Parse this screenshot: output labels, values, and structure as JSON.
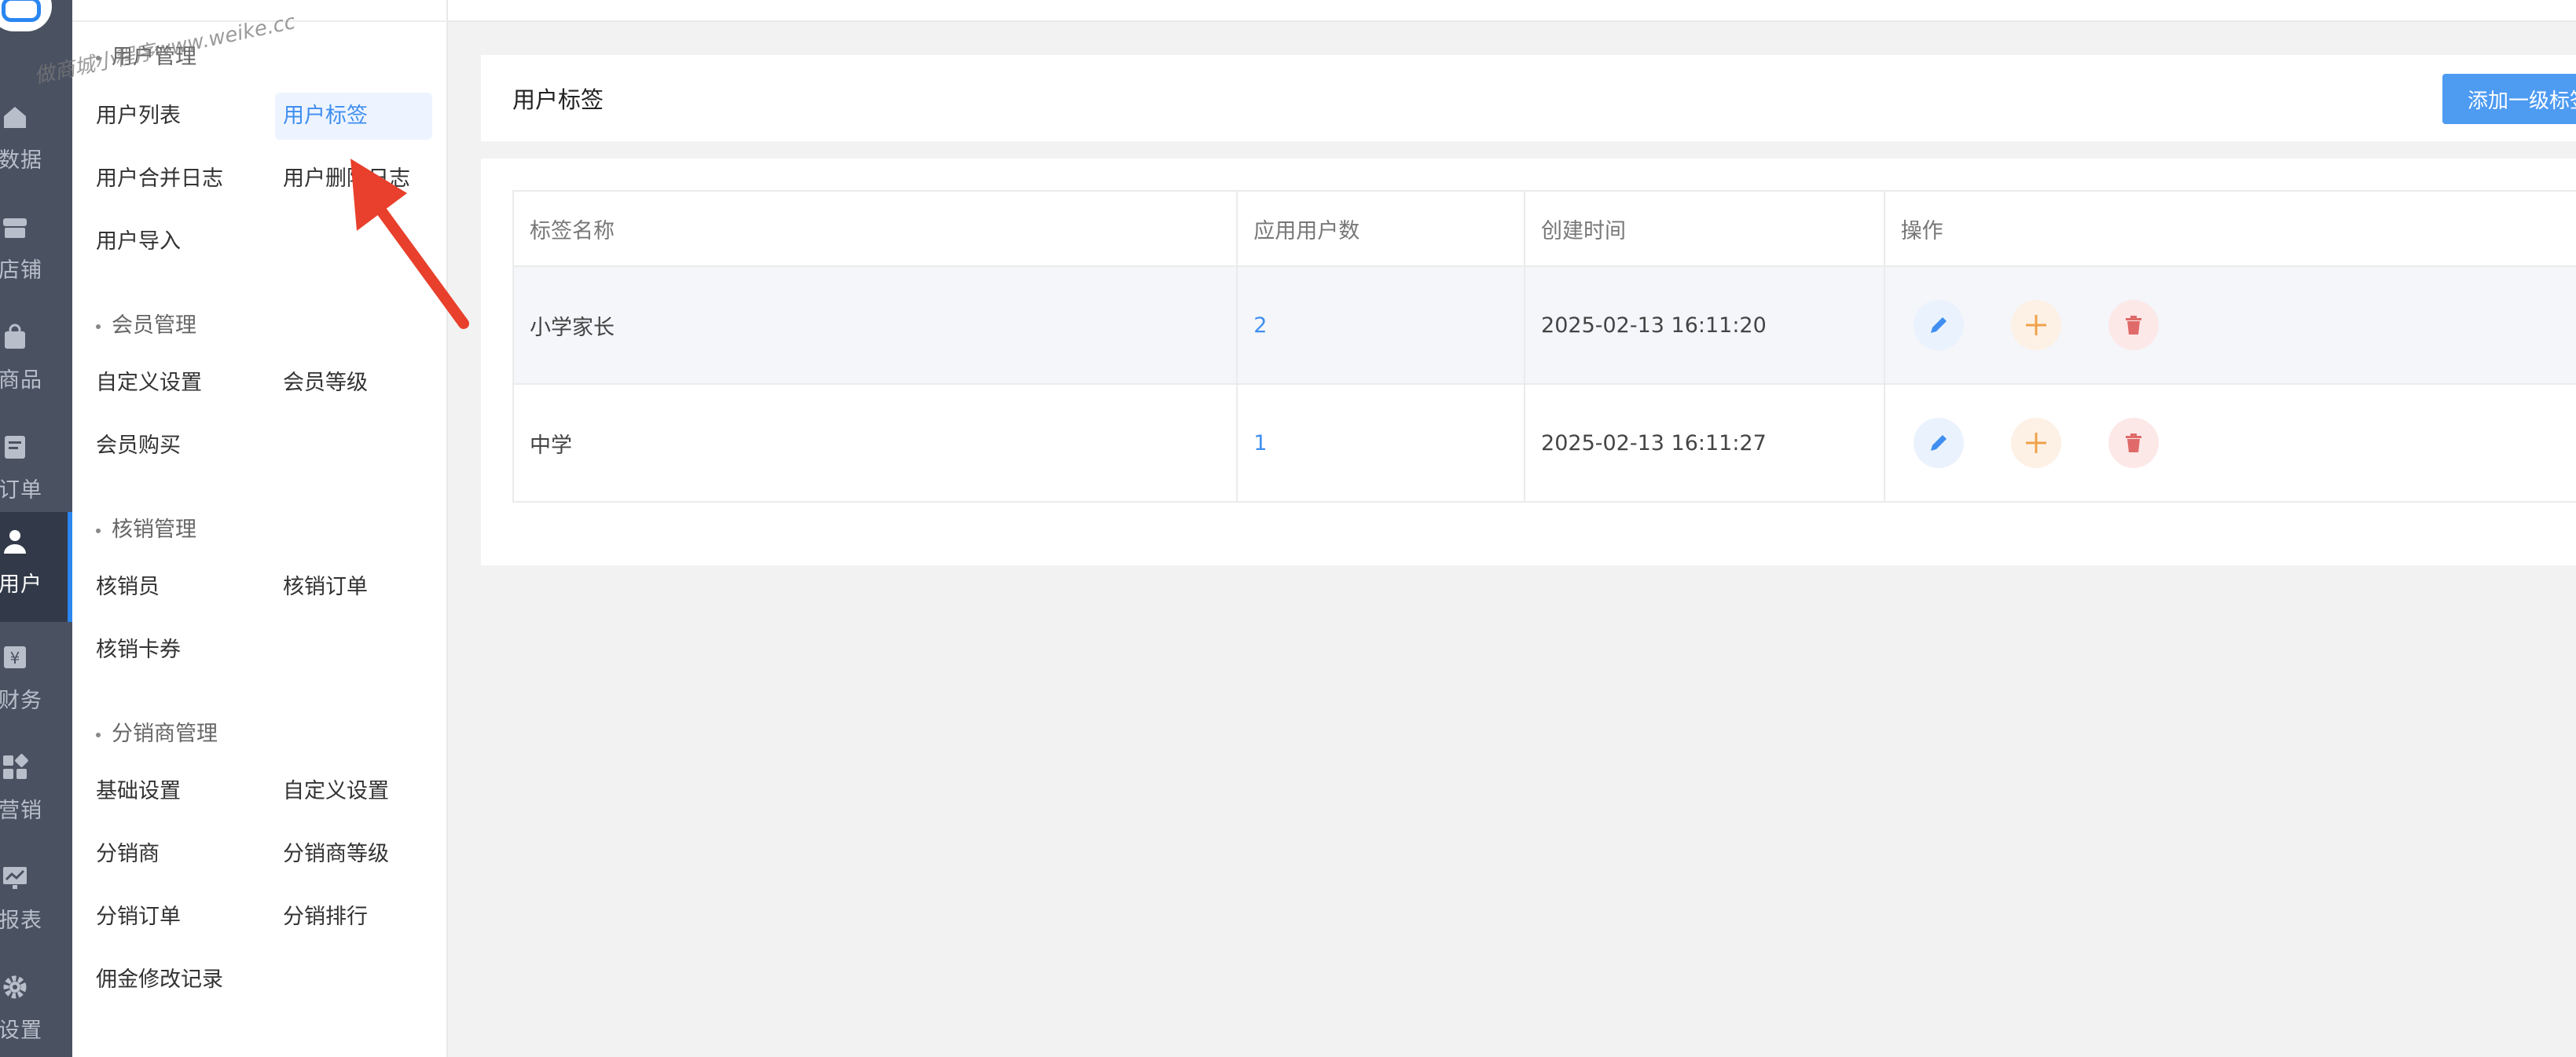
{
  "watermark": "做商城小程序www.weike.cc",
  "rail": {
    "items": [
      {
        "label": "数据",
        "icon": "home-icon"
      },
      {
        "label": "店铺",
        "icon": "store-icon"
      },
      {
        "label": "商品",
        "icon": "bag-icon"
      },
      {
        "label": "订单",
        "icon": "document-icon"
      },
      {
        "label": "用户",
        "icon": "user-icon",
        "active": true
      },
      {
        "label": "财务",
        "icon": "yen-icon"
      },
      {
        "label": "营销",
        "icon": "grid-icon"
      },
      {
        "label": "报表",
        "icon": "chart-icon"
      },
      {
        "label": "设置",
        "icon": "gear-icon"
      }
    ]
  },
  "submenu": {
    "sections": [
      {
        "title": "用户管理",
        "links": [
          "用户列表",
          "用户标签",
          "用户合并日志",
          "用户删除日志",
          "用户导入"
        ]
      },
      {
        "title": "会员管理",
        "links": [
          "自定义设置",
          "会员等级",
          "会员购买"
        ]
      },
      {
        "title": "核销管理",
        "links": [
          "核销员",
          "核销订单",
          "核销卡券"
        ]
      },
      {
        "title": "分销商管理",
        "links": [
          "基础设置",
          "自定义设置",
          "分销商",
          "分销商等级",
          "分销订单",
          "分销排行",
          "佣金修改记录"
        ]
      }
    ],
    "selected": "用户标签"
  },
  "page": {
    "title": "用户标签",
    "add_button": "添加一级标签"
  },
  "table": {
    "headers": [
      "标签名称",
      "应用用户数",
      "创建时间",
      "操作"
    ],
    "rows": [
      {
        "name": "小学家长",
        "count": "2",
        "created": "2025-02-13 16:11:20"
      },
      {
        "name": "中学",
        "count": "1",
        "created": "2025-02-13 16:11:27"
      }
    ]
  },
  "colors": {
    "accent": "#3f8ef0",
    "rail": "#4a5262",
    "annotation_arrow": "#e8402c"
  }
}
